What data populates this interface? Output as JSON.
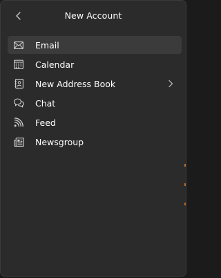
{
  "header": {
    "title": "New Account"
  },
  "menu": {
    "items": [
      {
        "label": "Email",
        "icon": "envelope-icon",
        "selected": true
      },
      {
        "label": "Calendar",
        "icon": "calendar-icon",
        "selected": false
      },
      {
        "label": "New Address Book",
        "icon": "address-book-icon",
        "selected": false,
        "has_submenu": true
      },
      {
        "label": "Chat",
        "icon": "chat-bubbles-icon",
        "selected": false
      },
      {
        "label": "Feed",
        "icon": "rss-feed-icon",
        "selected": false
      },
      {
        "label": "Newsgroup",
        "icon": "newsgroup-icon",
        "selected": false
      }
    ]
  },
  "colors": {
    "panel_background": "#2b2b2b",
    "selected_background": "#3b3b3b",
    "text": "#ffffff",
    "icon": "#d0d0d0"
  }
}
